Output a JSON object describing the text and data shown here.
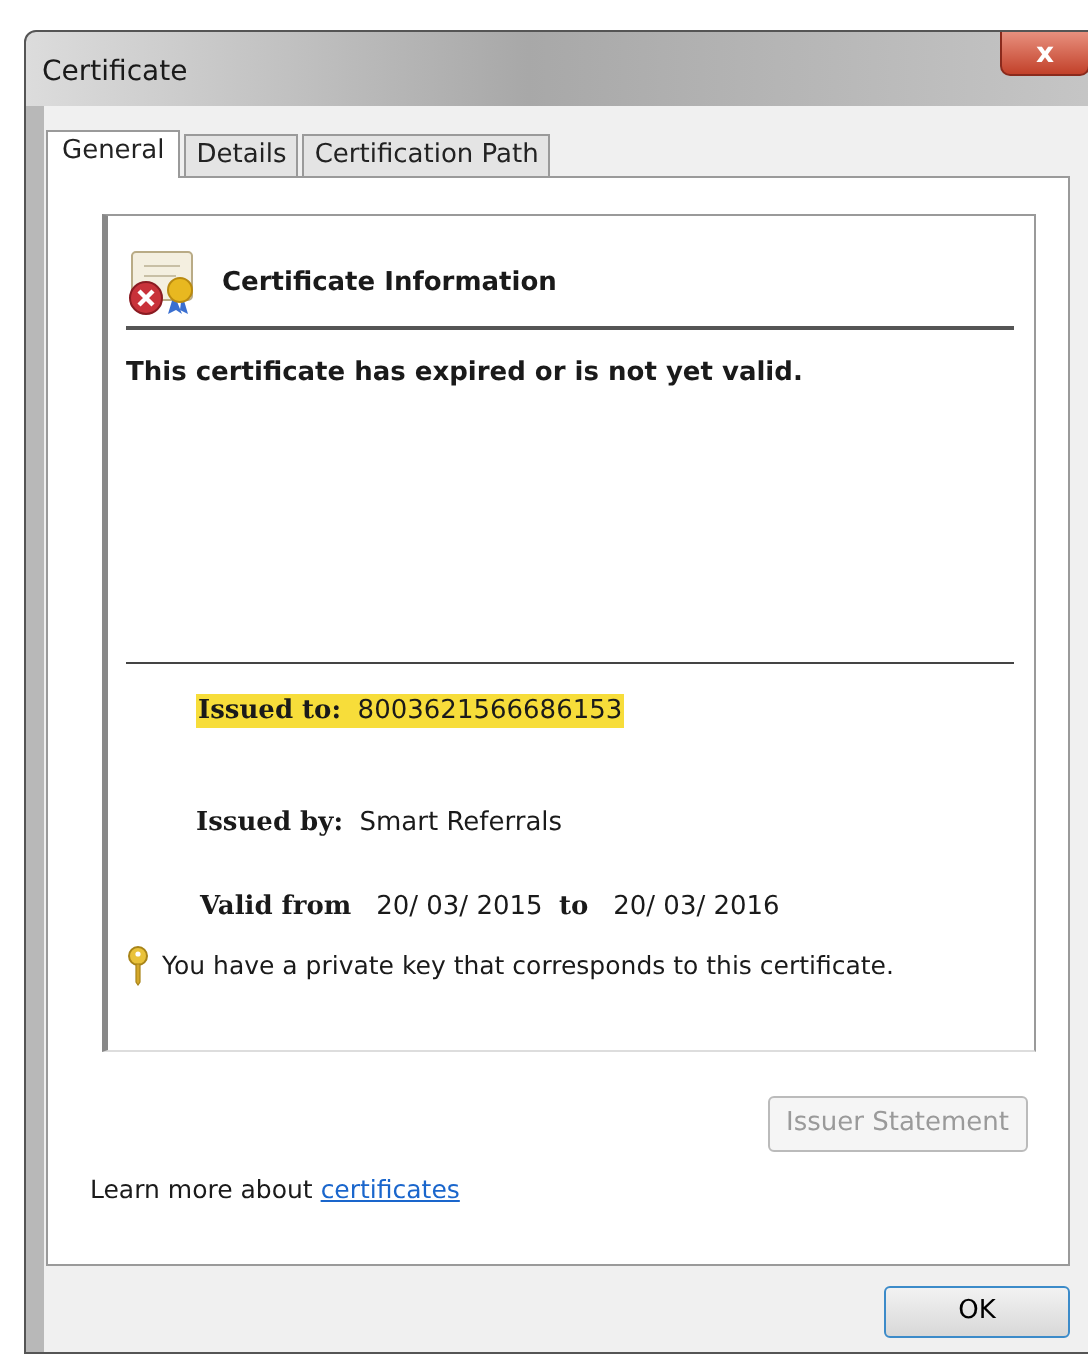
{
  "window": {
    "title": "Certificate",
    "close_label": "x"
  },
  "tabs": [
    {
      "label": "General",
      "selected": true
    },
    {
      "label": "Details",
      "selected": false
    },
    {
      "label": "Certification Path",
      "selected": false
    }
  ],
  "info": {
    "heading": "Certificate Information",
    "message": "This certificate has expired or is not yet valid.",
    "fields": [
      {
        "label": "Issued to:",
        "value": "8003621566686153",
        "highlighted": true
      },
      {
        "label": "Issued by:",
        "value": "Smart Referrals",
        "highlighted": false
      }
    ],
    "valid_label": "Valid from",
    "valid_from": "20/ 03/ 2015",
    "to_label": "to",
    "valid_to": "20/ 03/ 2016",
    "key_note": "You have a private key that corresponds to this certificate."
  },
  "issuer_button": {
    "label": "Issuer Statement",
    "disabled": true
  },
  "learn_more": {
    "text": "Learn more about",
    "link": "certificates"
  },
  "ok_button": {
    "label": "OK"
  }
}
